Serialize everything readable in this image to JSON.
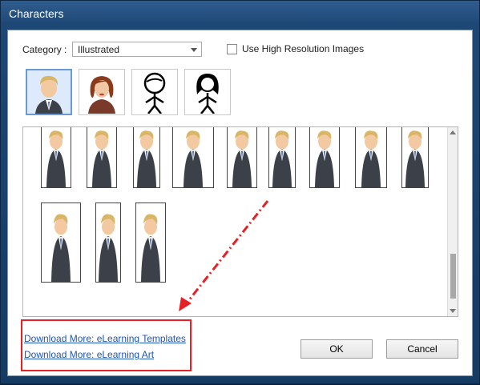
{
  "window": {
    "title": "Characters"
  },
  "category": {
    "label": "Category :",
    "selected": "Illustrated"
  },
  "hires": {
    "label": "Use High Resolution Images",
    "checked": false
  },
  "styles": [
    {
      "name": "illustrated-man",
      "selected": true
    },
    {
      "name": "illustrated-woman",
      "selected": false
    },
    {
      "name": "stick-man",
      "selected": false
    },
    {
      "name": "stick-woman",
      "selected": false
    }
  ],
  "links": {
    "templates": "Download More: eLearning Templates",
    "art": "Download More: eLearning Art"
  },
  "buttons": {
    "ok": "OK",
    "cancel": "Cancel"
  },
  "colors": {
    "accent": "#e52126",
    "link": "#1f56b5",
    "selection": "#6a9ad6"
  }
}
